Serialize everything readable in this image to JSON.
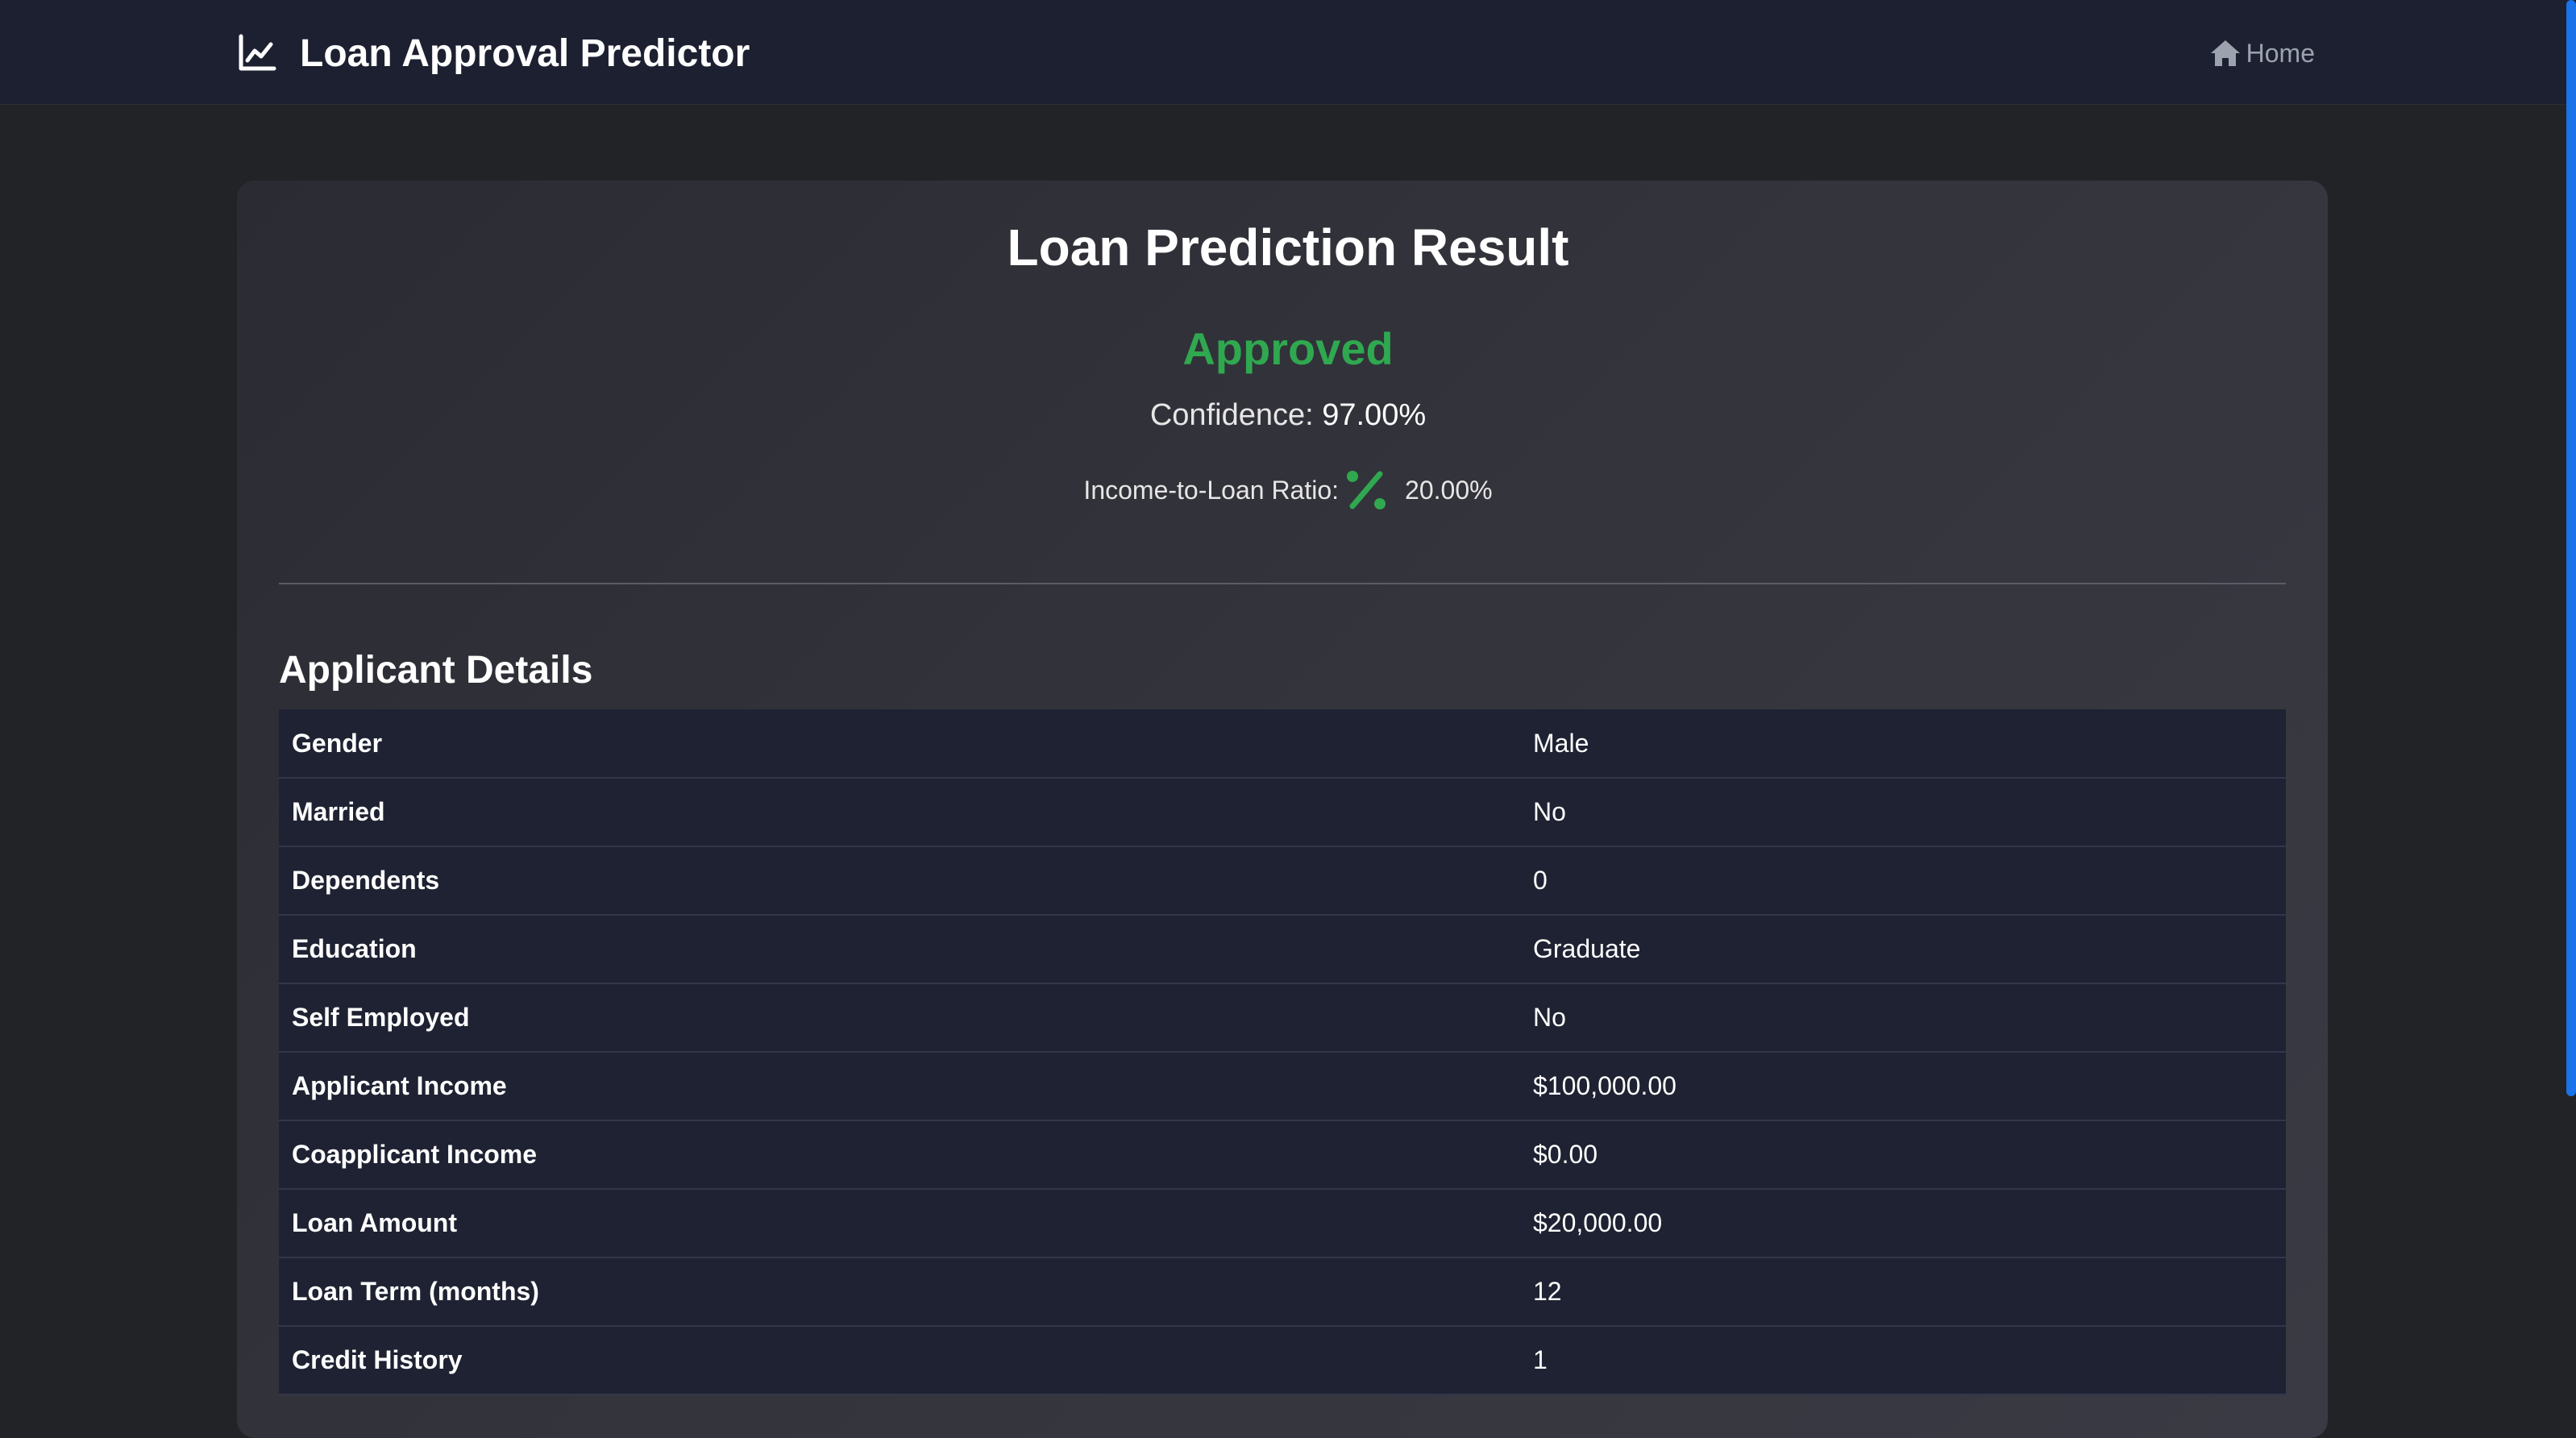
{
  "navbar": {
    "brand_icon": "chart-line-icon",
    "brand": "Loan Approval Predictor",
    "home_icon": "home-icon",
    "home_label": "Home"
  },
  "result": {
    "title": "Loan Prediction Result",
    "status": "Approved",
    "status_color": "#2fa84f",
    "confidence_label": "Confidence:",
    "confidence_value": "97.00%",
    "ratio_label": "Income-to-Loan Ratio:",
    "ratio_icon": "percent-icon",
    "ratio_value": "20.00%"
  },
  "details": {
    "title": "Applicant Details",
    "rows": [
      {
        "label": "Gender",
        "value": "Male"
      },
      {
        "label": "Married",
        "value": "No"
      },
      {
        "label": "Dependents",
        "value": "0"
      },
      {
        "label": "Education",
        "value": "Graduate"
      },
      {
        "label": "Self Employed",
        "value": "No"
      },
      {
        "label": "Applicant Income",
        "value": "$100,000.00"
      },
      {
        "label": "Coapplicant Income",
        "value": "$0.00"
      },
      {
        "label": "Loan Amount",
        "value": "$20,000.00"
      },
      {
        "label": "Loan Term (months)",
        "value": "12"
      },
      {
        "label": "Credit History",
        "value": "1"
      }
    ]
  }
}
